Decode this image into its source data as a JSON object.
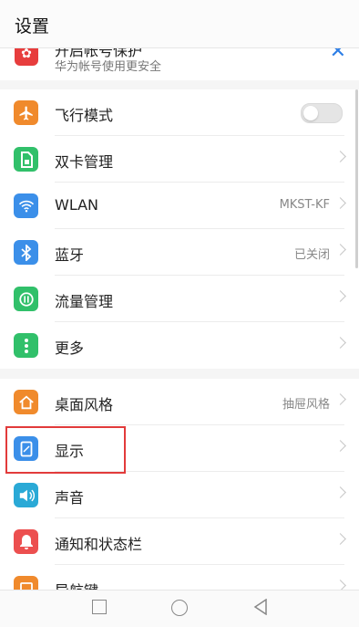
{
  "header": {
    "title": "设置"
  },
  "banner": {
    "title_cut": "开启帐号保护",
    "subtitle": "华为帐号使用更安全",
    "logo_icon": "huawei-logo",
    "close_icon": "close-icon"
  },
  "group1": [
    {
      "label": "飞行模式",
      "type": "toggle",
      "icon": "airplane-icon",
      "color": "#f08a2c"
    },
    {
      "label": "双卡管理",
      "type": "chevron",
      "icon": "sim-icon",
      "color": "#31c06a"
    },
    {
      "label": "WLAN",
      "type": "value",
      "value": "MKST-KF",
      "icon": "wifi-icon",
      "color": "#3b8fe9"
    },
    {
      "label": "蓝牙",
      "type": "value",
      "value": "已关闭",
      "icon": "bluetooth-icon",
      "color": "#3b8fe9"
    },
    {
      "label": "流量管理",
      "type": "chevron",
      "icon": "data-usage-icon",
      "color": "#31c06a"
    },
    {
      "label": "更多",
      "type": "chevron",
      "icon": "more-icon",
      "color": "#31c06a"
    }
  ],
  "group2": [
    {
      "label": "桌面风格",
      "type": "value",
      "value": "抽屉风格",
      "icon": "home-icon",
      "color": "#f08a2c"
    },
    {
      "label": "显示",
      "type": "chevron",
      "icon": "display-icon",
      "color": "#3b8fe9"
    },
    {
      "label": "声音",
      "type": "chevron",
      "icon": "volume-icon",
      "color": "#2aa9d6"
    },
    {
      "label": "通知和状态栏",
      "type": "chevron",
      "icon": "notification-icon",
      "color": "#ec4f4f"
    },
    {
      "label": "导航键",
      "type": "chevron",
      "icon": "nav-key-icon",
      "color": "#f08a2c"
    }
  ],
  "navbar": {
    "recent": "recent-apps-icon",
    "home": "home-button-icon",
    "back": "back-icon"
  }
}
